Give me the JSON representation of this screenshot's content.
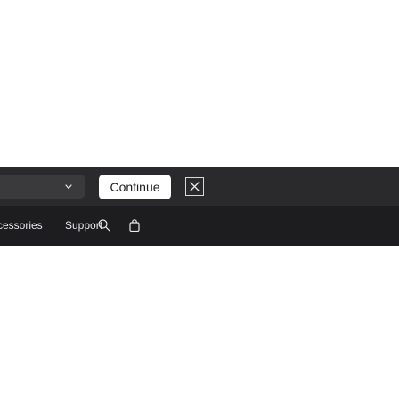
{
  "region_banner": {
    "selected_value": "",
    "continue_label": "Continue",
    "icons": {
      "select": "chevron-down-icon",
      "close": "close-icon"
    }
  },
  "global_nav": {
    "items": [
      {
        "label": "cessories"
      },
      {
        "label": "Support"
      }
    ],
    "icons": {
      "search": "search-icon",
      "bag": "bag-icon"
    }
  },
  "colors": {
    "banner_background": "#2a2a2c",
    "nav_background": "#1d1d1f",
    "nav_text": "#e8e8ed",
    "button_background": "#ffffff"
  }
}
